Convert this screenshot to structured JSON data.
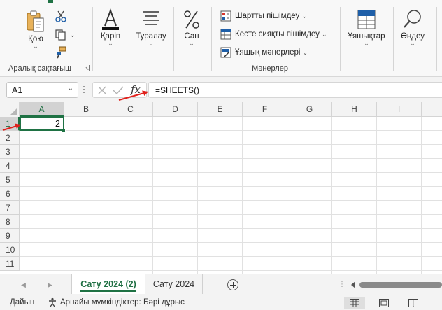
{
  "ribbon": {
    "clipboard": {
      "paste_label": "Қою",
      "footer": "Аралық сақтағыш"
    },
    "font": {
      "label": "Қаріп"
    },
    "alignment": {
      "label": "Туралау"
    },
    "number": {
      "label": "Сан"
    },
    "styles": {
      "conditional_formatting": "Шартты пішімдеу",
      "format_as_table": "Кесте сияқты пішімдеу",
      "cell_styles": "Ұяшық мәнерлері",
      "footer": "Мәнерлер"
    },
    "cells": {
      "label": "Ұяшықтар"
    },
    "editing": {
      "label": "Өңдеу"
    }
  },
  "formula_bar": {
    "name_box": "A1",
    "fx_label": "fx",
    "formula": "=SHEETS()"
  },
  "grid": {
    "columns": [
      "A",
      "B",
      "C",
      "D",
      "E",
      "F",
      "G",
      "H",
      "I"
    ],
    "rows": [
      "1",
      "2",
      "3",
      "4",
      "5",
      "6",
      "7",
      "8",
      "9",
      "10",
      "11"
    ],
    "selected_cell": {
      "ref": "A1",
      "value": "2"
    }
  },
  "sheets": {
    "tabs": [
      {
        "label": "Сату 2024 (2)",
        "active": true
      },
      {
        "label": "Сату 2024",
        "active": false
      }
    ]
  },
  "status_bar": {
    "mode": "Дайын",
    "accessibility": "Арнайы мүмкіндіктер: Бәрі дұрыс"
  },
  "colors": {
    "accent": "#1f7244",
    "annotation_arrow": "#e0201b"
  }
}
